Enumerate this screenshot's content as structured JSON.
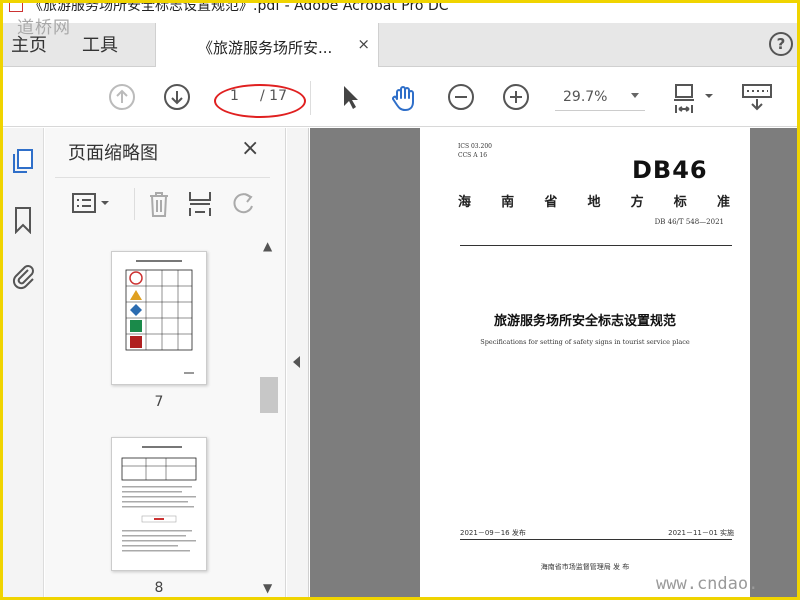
{
  "window": {
    "title": "《旅游服务场所安全标志设置规范》.pdf - Adobe Acrobat Pro DC"
  },
  "watermark": {
    "top": "道桥网",
    "bottom": "www.cndao."
  },
  "tabs": {
    "home": "主页",
    "tools": "工具",
    "document": "《旅游服务场所安...",
    "close": "×",
    "help": "?"
  },
  "toolbar": {
    "current_page": "1",
    "total_pages": "/ 17",
    "zoom": "29.7%"
  },
  "thumbnails": {
    "title": "页面缩略图",
    "close": "×",
    "pages": [
      {
        "number": "7"
      },
      {
        "number": "8"
      }
    ]
  },
  "document": {
    "ics": "ICS  03.200",
    "ccs": "CCS  A 16",
    "logo": "DB46",
    "region": [
      "海",
      "南",
      "省",
      "地",
      "方",
      "标",
      "准"
    ],
    "standard_no": "DB 46/T 548—2021",
    "title_zh": "旅游服务场所安全标志设置规范",
    "title_en": "Specifications for setting of safety signs in tourist service place",
    "issue_date": "2021－09－16 发布",
    "implement_date": "2021－11－01 实施",
    "publisher": "海南省市场监督管理局    发  布"
  },
  "colors": {
    "accent": "#2f6fc9",
    "annotation": "#e02020",
    "frame": "#f0d400"
  }
}
